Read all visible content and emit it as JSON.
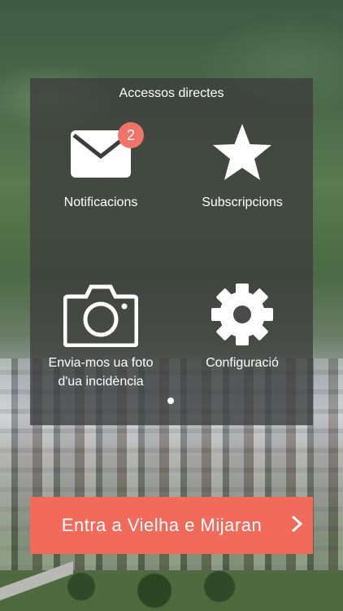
{
  "panel": {
    "title": "Accessos directes",
    "shortcuts": [
      {
        "label": "Notificacions",
        "icon": "mail-icon",
        "badge": "2"
      },
      {
        "label": "Subscripcions",
        "icon": "star-icon"
      },
      {
        "label": "Envia-mos ua foto d'ua incidència",
        "icon": "camera-icon"
      },
      {
        "label": "Configuració",
        "icon": "gear-icon"
      }
    ],
    "page_indicator": {
      "pages": 1,
      "current": 1
    }
  },
  "cta": {
    "label": "Entra a Vielha e Mijaran",
    "icon": "chevron-right-icon"
  },
  "colors": {
    "accent": "#f26a5a",
    "badge": "#f07468",
    "panel_overlay": "rgba(60,60,60,0.78)"
  }
}
